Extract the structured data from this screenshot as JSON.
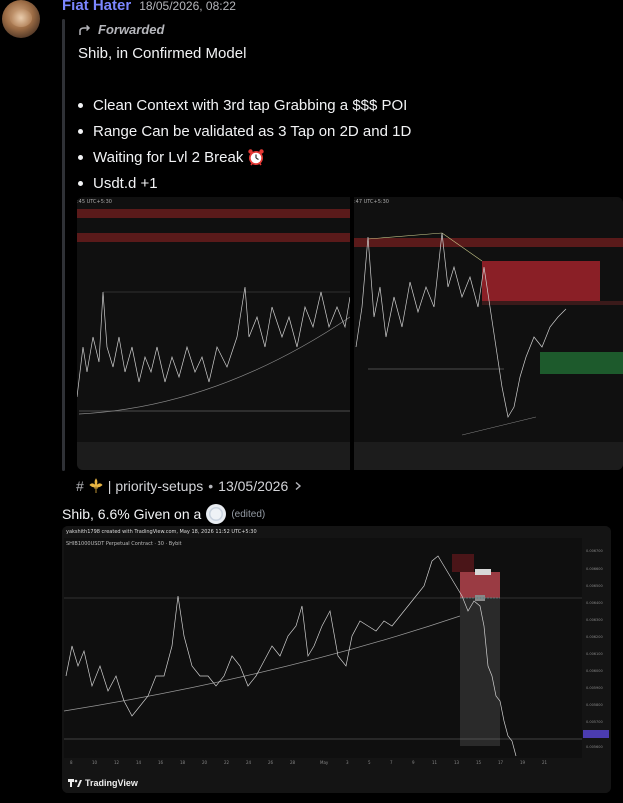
{
  "message": {
    "author": "Fiat Hater",
    "timestamp": "18/05/2026, 08:22",
    "author_color": "#7b86ff"
  },
  "forwarded": {
    "label": "Forwarded",
    "title": "Shib, in Confirmed Model",
    "bullets": [
      "Clean Context with 3rd tap Grabbing a $$$ POI",
      "Range Can be validated as 3 Tap on 2D and 1D",
      "Waiting for Lvl 2 Break",
      "Usdt.d +1"
    ],
    "bullet_emoji": "alarm-clock-icon",
    "images": {
      "left_caption": ":45 UTC+5:30",
      "right_caption": ":47 UTC+5:30"
    },
    "channel": {
      "hash": "#",
      "icon": "fleur-de-lis-icon",
      "name": "| priority-setups",
      "separator": "•",
      "date": "13/05/2026",
      "chevron": "chevron-right-icon"
    }
  },
  "reply": {
    "text": "Shib, 6.6% Given on a",
    "emoji": "plate-icon",
    "edited": "(edited)"
  },
  "tv_chart": {
    "header": "yakshith1798 created with TradingView.com, May 18, 2026 11:52 UTC+5:30",
    "symbol": "SHIB1000USDT Perpetual Contract · 30 · Bybit",
    "brand": "TradingView",
    "brand_icon": "tradingview-logo-icon",
    "accent_up": "#3f9d57",
    "accent_down": "#c0392b"
  }
}
